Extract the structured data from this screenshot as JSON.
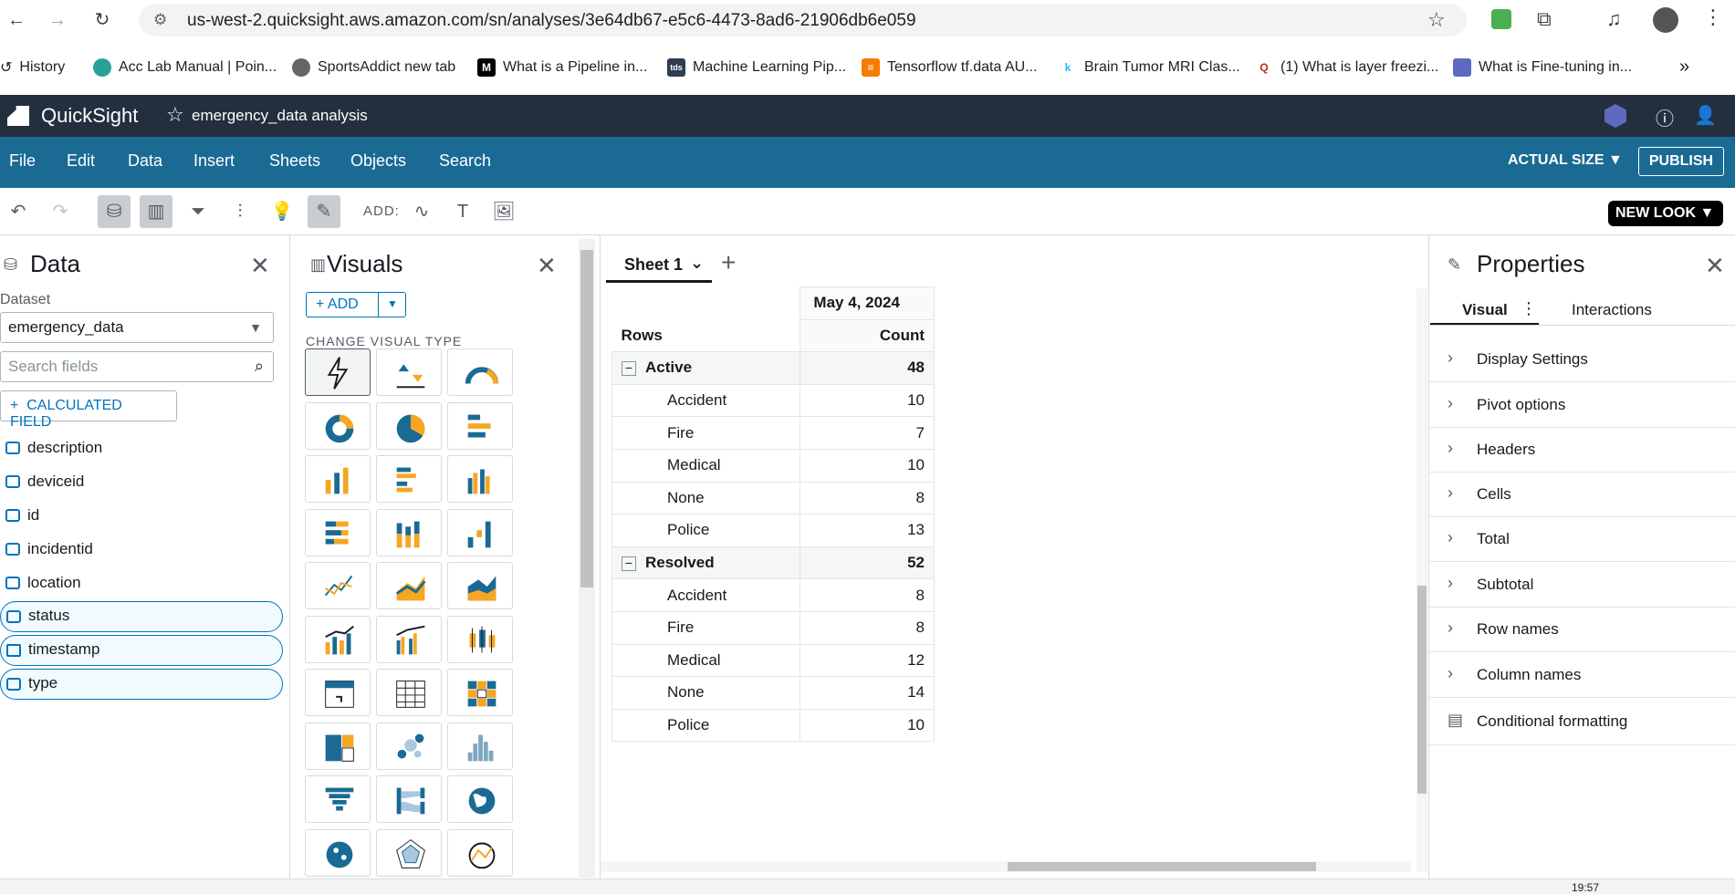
{
  "browser": {
    "url": "us-west-2.quicksight.aws.amazon.com/sn/analyses/3e64db67-e5c6-4473-8ad6-21906db6e059",
    "bookmarks": [
      {
        "label": "History"
      },
      {
        "label": "Acc Lab Manual | Poin..."
      },
      {
        "label": "SportsAddict new tab"
      },
      {
        "label": "What is a Pipeline in..."
      },
      {
        "label": "Machine Learning Pip..."
      },
      {
        "label": "Tensorflow tf.data AU..."
      },
      {
        "label": "Brain Tumor MRI Clas..."
      },
      {
        "label": "(1) What is layer freezi..."
      },
      {
        "label": "What is Fine-tuning in..."
      }
    ]
  },
  "app": {
    "name": "QuickSight",
    "analysis_name": "emergency_data analysis",
    "menu": [
      "File",
      "Edit",
      "Data",
      "Insert",
      "Sheets",
      "Objects",
      "Search"
    ],
    "actual_size": "ACTUAL SIZE",
    "publish": "PUBLISH",
    "add_label": "ADD:",
    "new_look": "NEW LOOK"
  },
  "data_pane": {
    "title": "Data",
    "dataset_label": "Dataset",
    "dataset": "emergency_data",
    "search_placeholder": "Search fields",
    "calc_field": "CALCULATED FIELD",
    "fields": [
      {
        "name": "description",
        "selected": false
      },
      {
        "name": "deviceid",
        "selected": false
      },
      {
        "name": "id",
        "selected": false
      },
      {
        "name": "incidentid",
        "selected": false
      },
      {
        "name": "location",
        "selected": false
      },
      {
        "name": "status",
        "selected": true
      },
      {
        "name": "timestamp",
        "selected": true
      },
      {
        "name": "type",
        "selected": true
      }
    ]
  },
  "visuals_pane": {
    "title": "Visuals",
    "add": "ADD",
    "change_type": "CHANGE VISUAL TYPE"
  },
  "sheet": {
    "tab": "Sheet 1",
    "column_header": "May 4, 2024",
    "rows_header": "Rows",
    "count_header": "Count",
    "groups": [
      {
        "name": "Active",
        "total": "48",
        "items": [
          {
            "name": "Accident",
            "value": "10"
          },
          {
            "name": "Fire",
            "value": "7"
          },
          {
            "name": "Medical",
            "value": "10"
          },
          {
            "name": "None",
            "value": "8"
          },
          {
            "name": "Police",
            "value": "13"
          }
        ]
      },
      {
        "name": "Resolved",
        "total": "52",
        "items": [
          {
            "name": "Accident",
            "value": "8"
          },
          {
            "name": "Fire",
            "value": "8"
          },
          {
            "name": "Medical",
            "value": "12"
          },
          {
            "name": "None",
            "value": "14"
          },
          {
            "name": "Police",
            "value": "10"
          }
        ]
      }
    ]
  },
  "properties": {
    "title": "Properties",
    "tab_visual": "Visual",
    "tab_interactions": "Interactions",
    "sections": [
      "Display Settings",
      "Pivot options",
      "Headers",
      "Cells",
      "Total",
      "Subtotal",
      "Row names",
      "Column names",
      "Conditional formatting"
    ]
  },
  "taskbar": {
    "time": "19:57"
  },
  "colors": {
    "menubar": "#1a6a94",
    "topbar": "#232f3e",
    "accent": "#0073bb",
    "chart_orange": "#f5a623",
    "chart_blue": "#1a6a94"
  }
}
